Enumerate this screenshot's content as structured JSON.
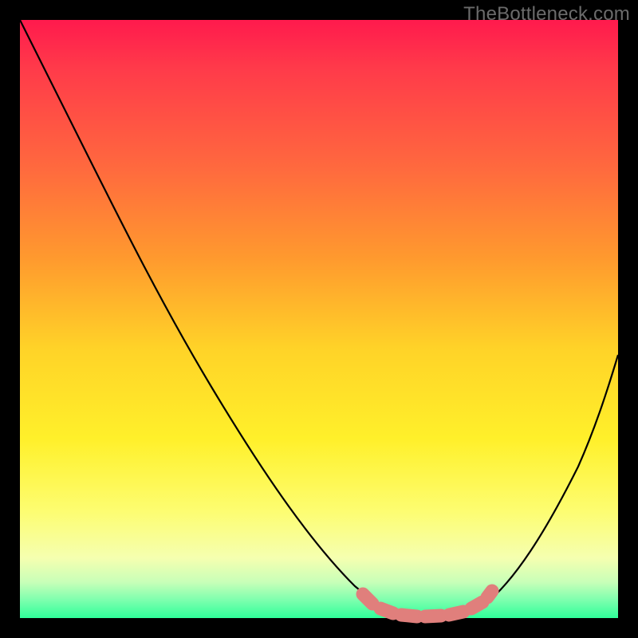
{
  "watermark": "TheBottleneck.com",
  "chart_data": {
    "type": "line",
    "title": "",
    "xlabel": "",
    "ylabel": "",
    "xlim": [
      0,
      100
    ],
    "ylim": [
      0,
      100
    ],
    "legend": false,
    "grid": false,
    "background_gradient": [
      {
        "pos": 0,
        "color": "#ff1a4d"
      },
      {
        "pos": 25,
        "color": "#ff6a3e"
      },
      {
        "pos": 55,
        "color": "#ffd328"
      },
      {
        "pos": 82,
        "color": "#fdfd70"
      },
      {
        "pos": 94,
        "color": "#c8ffb8"
      },
      {
        "pos": 100,
        "color": "#2fff9a"
      }
    ],
    "series": [
      {
        "name": "bottleneck-curve",
        "color": "#000000",
        "x": [
          0,
          5,
          10,
          15,
          20,
          25,
          30,
          35,
          40,
          45,
          50,
          55,
          58,
          60,
          63,
          66,
          70,
          73,
          77,
          80,
          84,
          88,
          92,
          96,
          100
        ],
        "y": [
          100,
          94,
          86,
          78,
          70,
          62,
          54,
          46,
          38,
          30,
          22,
          14,
          9,
          5,
          2,
          1,
          0,
          0,
          1,
          3,
          8,
          16,
          26,
          38,
          52
        ]
      },
      {
        "name": "optimal-band",
        "color": "#e07f7c",
        "style": "thick-dotted",
        "x": [
          58,
          60,
          63,
          66,
          70,
          73,
          77
        ],
        "y": [
          3,
          1.5,
          0.7,
          0.4,
          0.4,
          0.7,
          1.8
        ]
      }
    ],
    "annotations": []
  }
}
